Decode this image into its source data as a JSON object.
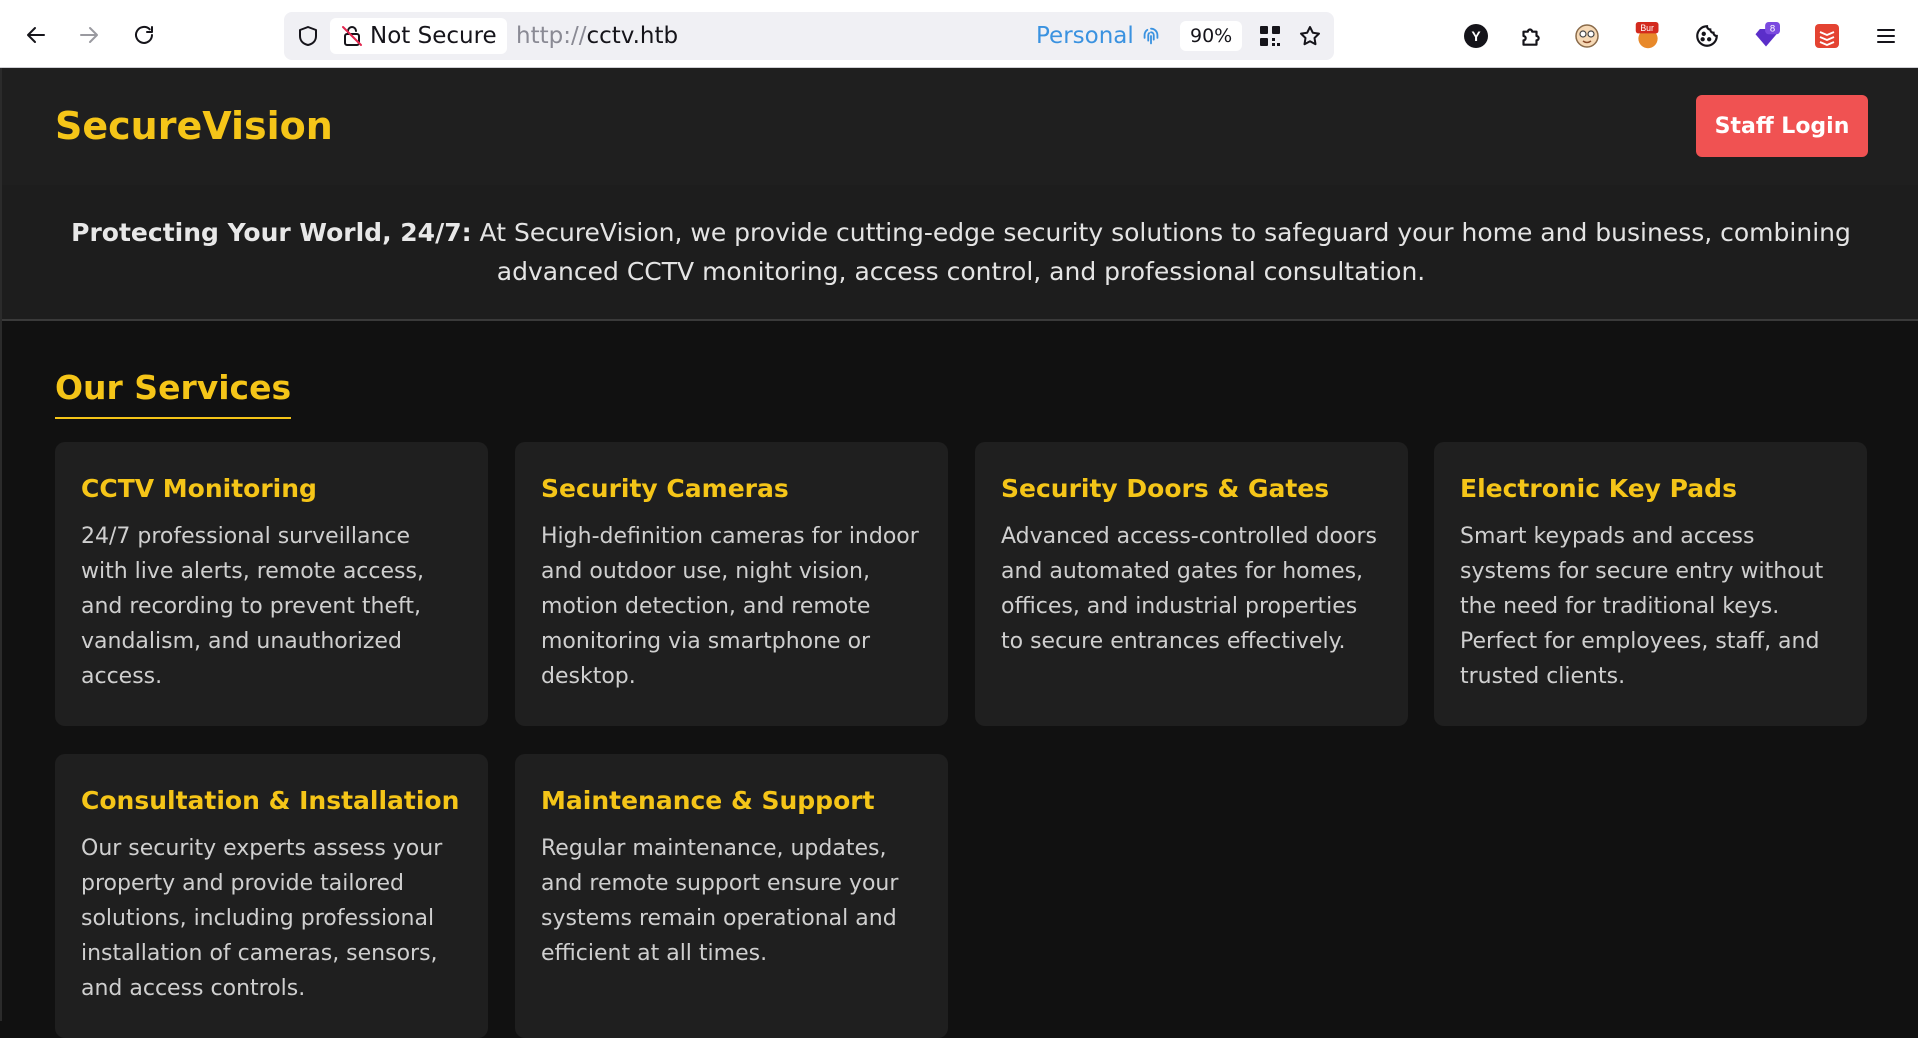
{
  "browser": {
    "security_label": "Not Secure",
    "url_protocol": "http://",
    "url_host": "cctv.htb",
    "container_label": "Personal",
    "zoom": "90%",
    "ext_badge_bur": "Bur",
    "ext_badge_count": "8"
  },
  "site": {
    "brand": "SecureVision",
    "login_label": "Staff Login",
    "hero_bold": "Protecting Your World, 24/7:",
    "hero_text": " At SecureVision, we provide cutting-edge security solutions to safeguard your home and business, combining advanced CCTV monitoring, access control, and professional consultation.",
    "services_title": "Our Services",
    "services": [
      {
        "title": "CCTV Monitoring",
        "desc": "24/7 professional surveillance with live alerts, remote access, and recording to prevent theft, vandalism, and unauthorized access."
      },
      {
        "title": "Security Cameras",
        "desc": "High-definition cameras for indoor and outdoor use, night vision, motion detection, and remote monitoring via smartphone or desktop."
      },
      {
        "title": "Security Doors & Gates",
        "desc": "Advanced access-controlled doors and automated gates for homes, offices, and industrial properties to secure entrances effectively."
      },
      {
        "title": "Electronic Key Pads",
        "desc": "Smart keypads and access systems for secure entry without the need for traditional keys. Perfect for employees, staff, and trusted clients."
      },
      {
        "title": "Consultation & Installation",
        "desc": "Our security experts assess your property and provide tailored solutions, including professional installation of cameras, sensors, and access controls."
      },
      {
        "title": "Maintenance & Support",
        "desc": "Regular maintenance, updates, and remote support ensure your systems remain operational and efficient at all times."
      }
    ]
  },
  "colors": {
    "accent": "#f5c518",
    "login_button": "#f05252",
    "background": "#111111",
    "card": "#1f1f1f"
  }
}
